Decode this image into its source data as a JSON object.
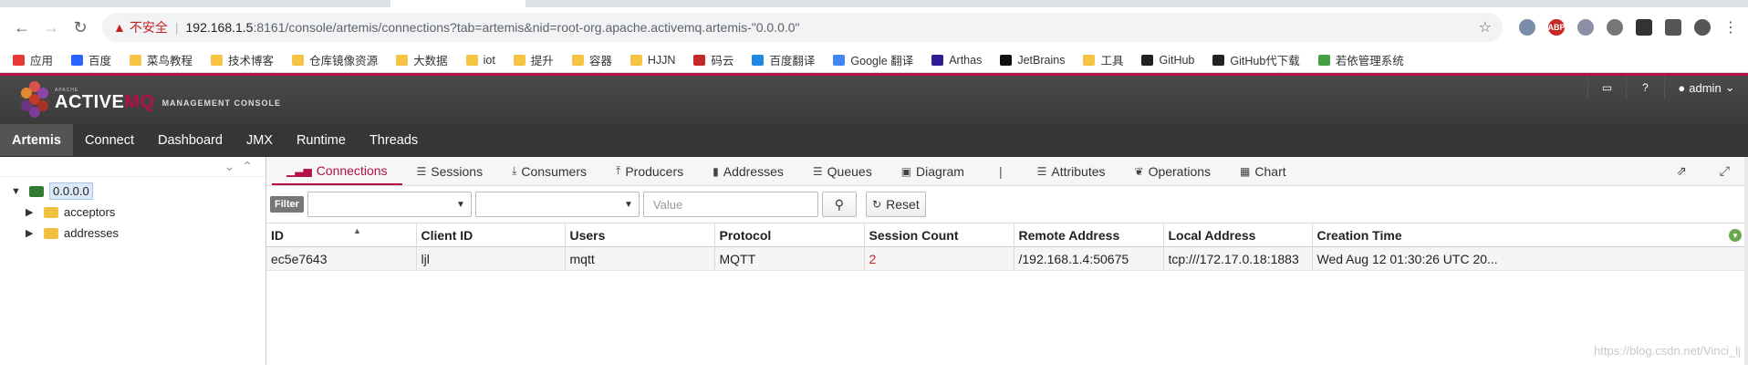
{
  "browser": {
    "nav": {
      "back": "←",
      "forward": "→",
      "reload": "↻"
    },
    "omnibox": {
      "warning_icon": "warning-icon",
      "insecure_label": "不安全",
      "url_host": "192.168.1.5",
      "url_rest": ":8161/console/artemis/connections?tab=artemis&nid=root-org.apache.activemq.artemis-\"0.0.0.0\"",
      "star_icon": "☆"
    },
    "bookmarks": [
      {
        "label": "应用",
        "icon": "apps-icon"
      },
      {
        "label": "百度",
        "icon": "baidu-icon"
      },
      {
        "label": "菜鸟教程",
        "icon": "folder-icon"
      },
      {
        "label": "技术博客",
        "icon": "folder-icon"
      },
      {
        "label": "仓库镜像资源",
        "icon": "folder-icon"
      },
      {
        "label": "大数据",
        "icon": "folder-icon"
      },
      {
        "label": "iot",
        "icon": "folder-icon"
      },
      {
        "label": "提升",
        "icon": "folder-icon"
      },
      {
        "label": "容器",
        "icon": "folder-icon"
      },
      {
        "label": "HJJN",
        "icon": "folder-icon"
      },
      {
        "label": "码云",
        "icon": "gitee-icon"
      },
      {
        "label": "百度翻译",
        "icon": "baidu-translate-icon"
      },
      {
        "label": "Google 翻译",
        "icon": "google-translate-icon"
      },
      {
        "label": "Arthas",
        "icon": "arthas-icon"
      },
      {
        "label": "JetBrains",
        "icon": "jetbrains-icon"
      },
      {
        "label": "工具",
        "icon": "folder-icon"
      },
      {
        "label": "GitHub",
        "icon": "github-icon"
      },
      {
        "label": "GitHub代下载",
        "icon": "github-icon"
      },
      {
        "label": "若依管理系统",
        "icon": "ruoyi-icon"
      }
    ]
  },
  "header": {
    "logo": {
      "apache": "APACHE",
      "brand_main": "ACTIVE",
      "brand_mq": "MQ",
      "console": "MANAGEMENT CONSOLE"
    },
    "user": "admin",
    "colors": {
      "accent": "#b30f4a",
      "header_bg": "#3b3b3b"
    }
  },
  "nav": {
    "items": [
      "Artemis",
      "Connect",
      "Dashboard",
      "JMX",
      "Runtime",
      "Threads"
    ],
    "active": "Artemis"
  },
  "tree": {
    "root": "0.0.0.0",
    "children": [
      "acceptors",
      "addresses"
    ]
  },
  "subtabs": {
    "items": [
      {
        "label": "Connections",
        "icon": "signal-icon"
      },
      {
        "label": "Sessions",
        "icon": "list-icon"
      },
      {
        "label": "Consumers",
        "icon": "download-icon"
      },
      {
        "label": "Producers",
        "icon": "upload-icon"
      },
      {
        "label": "Addresses",
        "icon": "book-icon"
      },
      {
        "label": "Queues",
        "icon": "list-icon"
      },
      {
        "label": "Diagram",
        "icon": "picture-icon"
      },
      {
        "label": "|",
        "icon": ""
      },
      {
        "label": "Attributes",
        "icon": "list-icon"
      },
      {
        "label": "Operations",
        "icon": "leaf-icon"
      },
      {
        "label": "Chart",
        "icon": "chart-icon"
      }
    ],
    "active": "Connections"
  },
  "filter": {
    "label": "Filter",
    "value_placeholder": "Value",
    "reset_label": "Reset"
  },
  "table": {
    "columns": [
      "ID",
      "Client ID",
      "Users",
      "Protocol",
      "Session Count",
      "Remote Address",
      "Local Address",
      "Creation Time"
    ],
    "rows": [
      [
        "ec5e7643",
        "ljl",
        "mqtt",
        "MQTT",
        "2",
        "/192.168.1.4:50675",
        "tcp:///172.17.0.18:1883",
        "Wed Aug 12 01:30:26 UTC 20..."
      ]
    ]
  },
  "watermark": "https://blog.csdn.net/Vinci_lj"
}
